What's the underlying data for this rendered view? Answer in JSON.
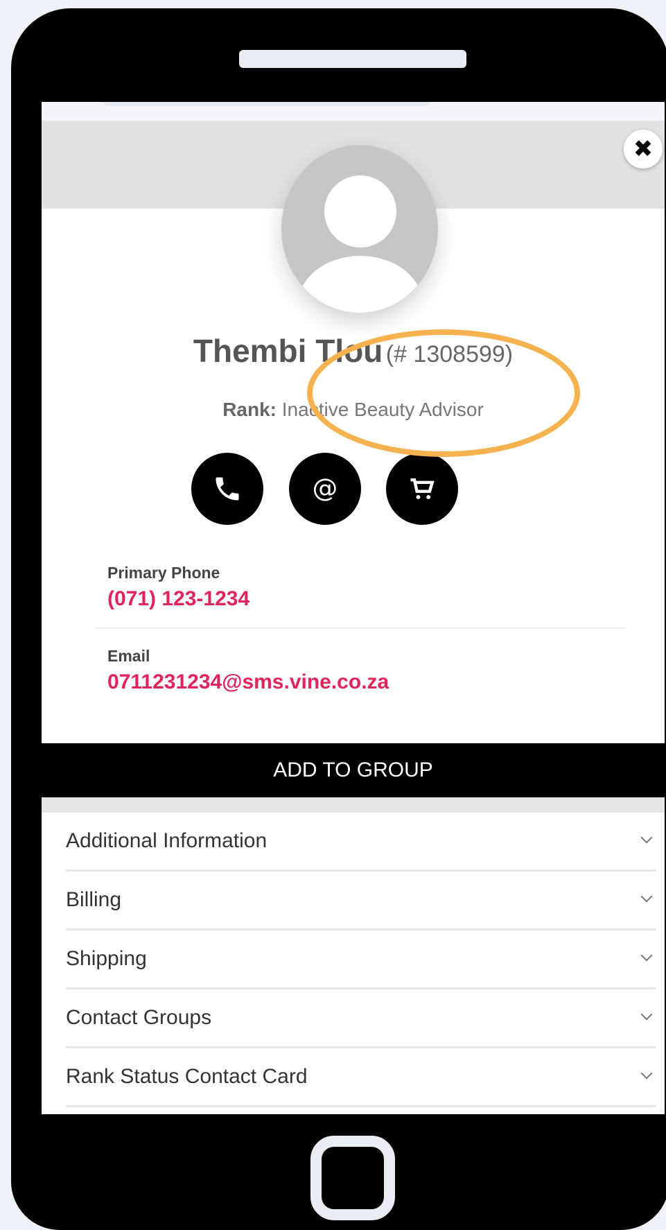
{
  "contact": {
    "name": "Thembi Tlou",
    "id_text": "(# 1308599)",
    "rank_label": "Rank:",
    "rank_value": "Inactive Beauty Advisor"
  },
  "actions": [
    {
      "icon": "phone-icon"
    },
    {
      "icon": "email-icon"
    },
    {
      "icon": "cart-icon"
    }
  ],
  "details": {
    "phone_label": "Primary Phone",
    "phone_value": "(071) 123-1234",
    "email_label": "Email",
    "email_value": "0711231234@sms.vine.co.za"
  },
  "add_group_label": "ADD TO GROUP",
  "sections": [
    {
      "label": "Additional Information"
    },
    {
      "label": "Billing"
    },
    {
      "label": "Shipping"
    },
    {
      "label": "Contact Groups"
    },
    {
      "label": "Rank Status Contact Card"
    }
  ],
  "colors": {
    "accent": "#e0245e",
    "highlight": "#f5b24f",
    "frame": "#000000"
  }
}
